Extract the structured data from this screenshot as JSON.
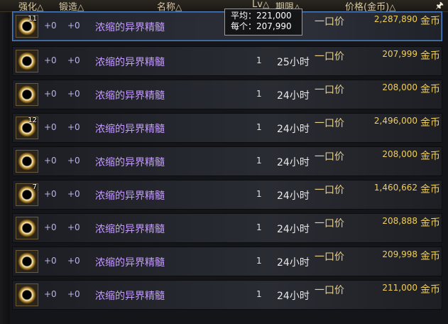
{
  "header": {
    "enhance": "强化",
    "forge": "锻造",
    "name": "名称",
    "lv": "Lv",
    "period": "期限",
    "price": "价格(金币)",
    "sort_mark": "△",
    "pin": "🖈"
  },
  "tooltip": {
    "avg_label": "平均：",
    "avg_value": "221,000",
    "each_label": "每个：",
    "each_value": "207,990"
  },
  "rows": [
    {
      "qty": "11",
      "enhance": "+0",
      "forge": "+0",
      "name": "浓缩的异界精髓",
      "lv": "",
      "period": "",
      "price_type": "一口价",
      "price": "2,287,890",
      "currency": "金币",
      "selected": true
    },
    {
      "qty": "",
      "enhance": "+0",
      "forge": "+0",
      "name": "浓缩的异界精髓",
      "lv": "1",
      "period": "25小时",
      "price_type": "一口价",
      "price": "207,999",
      "currency": "金币",
      "selected": false
    },
    {
      "qty": "",
      "enhance": "+0",
      "forge": "+0",
      "name": "浓缩的异界精髓",
      "lv": "1",
      "period": "24小时",
      "price_type": "一口价",
      "price": "208,000",
      "currency": "金币",
      "selected": false
    },
    {
      "qty": "12",
      "enhance": "+0",
      "forge": "+0",
      "name": "浓缩的异界精髓",
      "lv": "1",
      "period": "24小时",
      "price_type": "一口价",
      "price": "2,496,000",
      "currency": "金币",
      "selected": false
    },
    {
      "qty": "",
      "enhance": "+0",
      "forge": "+0",
      "name": "浓缩的异界精髓",
      "lv": "1",
      "period": "24小时",
      "price_type": "一口价",
      "price": "208,000",
      "currency": "金币",
      "selected": false
    },
    {
      "qty": "7",
      "enhance": "+0",
      "forge": "+0",
      "name": "浓缩的异界精髓",
      "lv": "1",
      "period": "24小时",
      "price_type": "一口价",
      "price": "1,460,662",
      "currency": "金币",
      "selected": false
    },
    {
      "qty": "",
      "enhance": "+0",
      "forge": "+0",
      "name": "浓缩的异界精髓",
      "lv": "1",
      "period": "24小时",
      "price_type": "一口价",
      "price": "208,888",
      "currency": "金币",
      "selected": false
    },
    {
      "qty": "",
      "enhance": "+0",
      "forge": "+0",
      "name": "浓缩的异界精髓",
      "lv": "1",
      "period": "24小时",
      "price_type": "一口价",
      "price": "209,998",
      "currency": "金币",
      "selected": false
    },
    {
      "qty": "",
      "enhance": "+0",
      "forge": "+0",
      "name": "浓缩的异界精髓",
      "lv": "1",
      "period": "24小时",
      "price_type": "一口价",
      "price": "211,000",
      "currency": "金币",
      "selected": false
    }
  ]
}
